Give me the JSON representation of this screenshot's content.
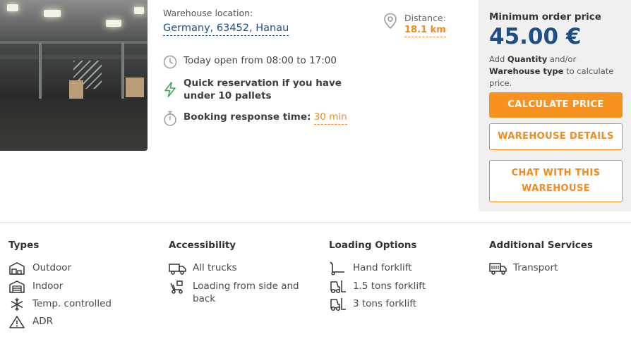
{
  "location": {
    "label": "Warehouse location:",
    "value": "Germany, 63452, Hanau",
    "distance_label": "Distance:",
    "distance_value": "18.1 km"
  },
  "features": {
    "hours": "Today open from 08:00 to 17:00",
    "quick_reservation": "Quick reservation if you have under 10 pallets",
    "booking_label": "Booking response time:",
    "booking_value": "30 min"
  },
  "price_box": {
    "title": "Minimum order price",
    "price": "45.00 €",
    "note_prefix": "Add",
    "note_quantity": "Quantity",
    "note_middle": "and/or",
    "note_type": "Warehouse type",
    "note_suffix": "to calculate price.",
    "calculate_label": "CALCULATE PRICE",
    "details_label": "WAREHOUSE DETAILS",
    "chat_label_line1": "CHAT WITH THIS",
    "chat_label_line2": "WAREHOUSE"
  },
  "sections": {
    "types": {
      "title": "Types",
      "items": [
        {
          "label": "Outdoor",
          "icon": "outdoor-warehouse-icon"
        },
        {
          "label": "Indoor",
          "icon": "indoor-warehouse-icon"
        },
        {
          "label": "Temp. controlled",
          "icon": "snowflake-icon"
        },
        {
          "label": "ADR",
          "icon": "hazard-warning-icon"
        }
      ]
    },
    "accessibility": {
      "title": "Accessibility",
      "items": [
        {
          "label": "All trucks",
          "icon": "truck-icon"
        },
        {
          "label_line1": "Loading from side and",
          "label_line2": "back",
          "icon": "loading-icon"
        }
      ]
    },
    "loading": {
      "title": "Loading Options",
      "items": [
        {
          "label": "Hand forklift",
          "icon": "hand-forklift-icon"
        },
        {
          "label": "1.5 tons forklift",
          "icon": "forklift-icon"
        },
        {
          "label": "3 tons forklift",
          "icon": "forklift-icon"
        }
      ]
    },
    "services": {
      "title": "Additional Services",
      "items": [
        {
          "label": "Transport",
          "icon": "transport-truck-icon"
        }
      ]
    }
  },
  "colors": {
    "accent": "#f7921e",
    "primary_blue": "#1d4f86",
    "panel": "#f0f0f0",
    "lightning_green": "#3aa655"
  }
}
